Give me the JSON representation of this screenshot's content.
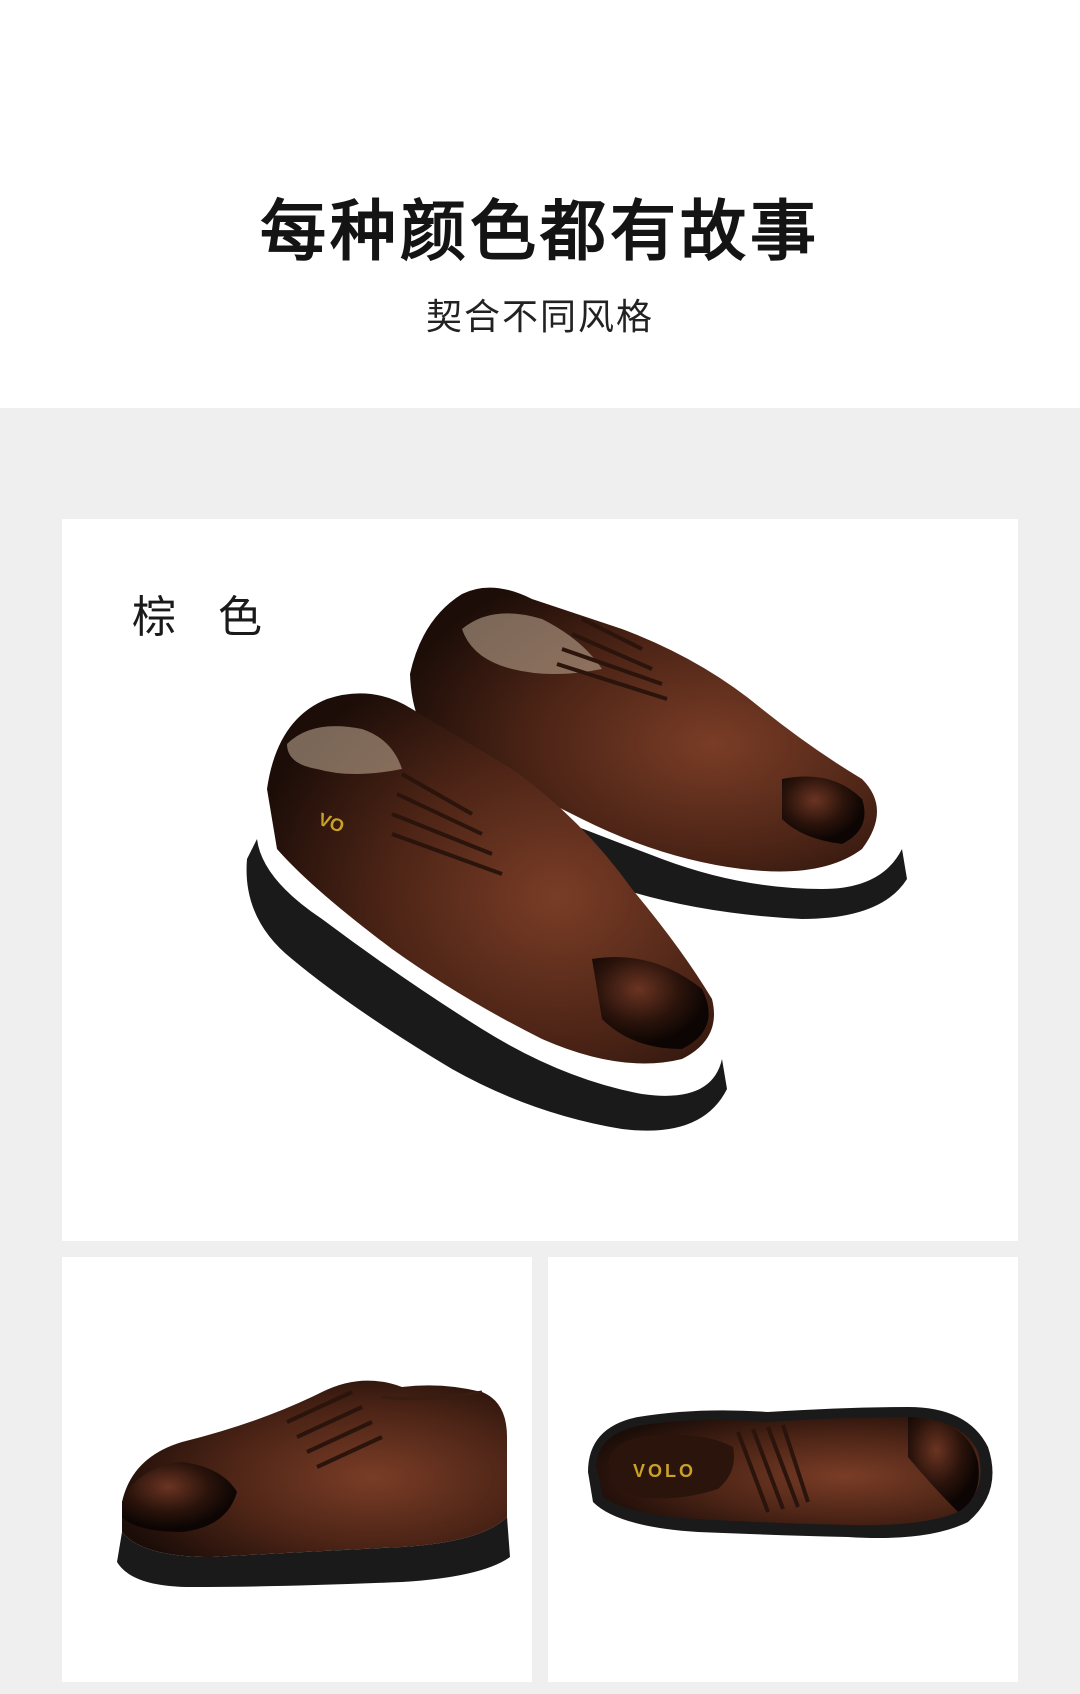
{
  "header": {
    "title": "每种颜色都有故事",
    "subtitle": "契合不同风格"
  },
  "main_card": {
    "color_label": "棕 色"
  },
  "insole_logo": "VOLO",
  "colors": {
    "background": "#efefef",
    "card": "#ffffff",
    "leather": "#5a2e1c",
    "sole": "#1a1a1a",
    "logo": "#c9a227"
  }
}
